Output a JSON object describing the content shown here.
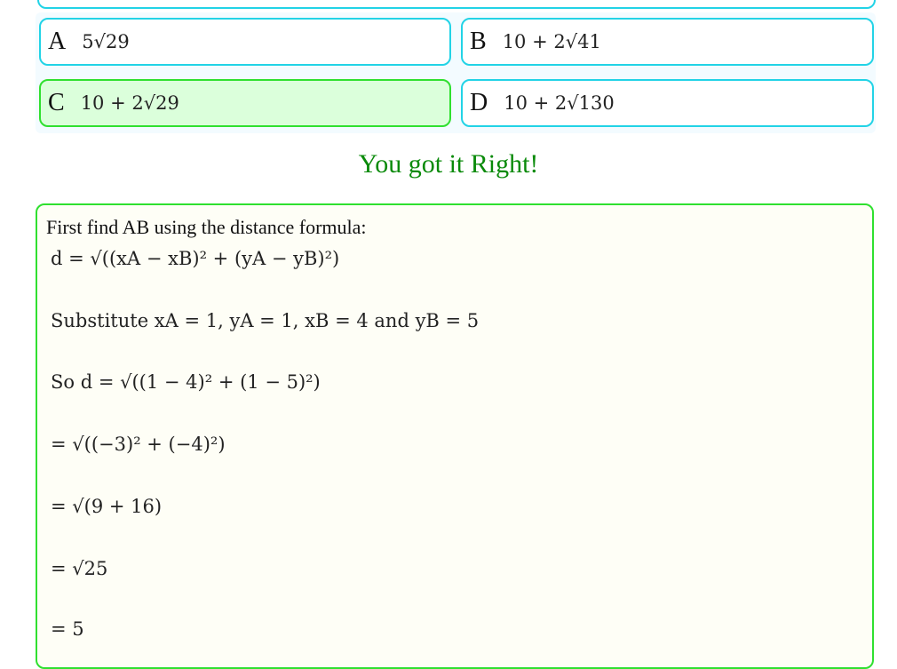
{
  "options": [
    {
      "letter": "A",
      "value": "5√29",
      "state": "neutral"
    },
    {
      "letter": "B",
      "value": "10 + 2√41",
      "state": "neutral"
    },
    {
      "letter": "C",
      "value": "10 + 2√29",
      "state": "correct"
    },
    {
      "letter": "D",
      "value": "10 + 2√130",
      "state": "neutral"
    }
  ],
  "feedback": "You got it Right!",
  "solution": {
    "intro": "First find AB using the distance formula:",
    "steps": [
      "d = √((xA − xB)² + (yA − yB)²)",
      "Substitute xA = 1, yA = 1, xB = 4 and yB = 5",
      "So d = √((1 − 4)² + (1 − 5)²)",
      "= √((−3)² + (−4)²)",
      "= √(9 + 16)",
      "= √25",
      "= 5"
    ]
  },
  "colors": {
    "option_border": "#22d3e6",
    "correct_border": "#2fe02f",
    "correct_bg": "#dbffdb",
    "feedback_text": "#0a8a0a"
  }
}
